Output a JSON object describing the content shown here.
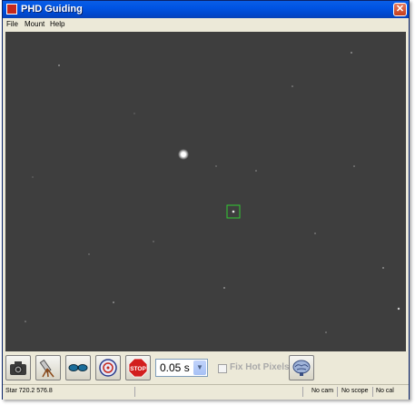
{
  "window": {
    "title": "PHD Guiding",
    "close_glyph": "✕"
  },
  "menu": {
    "items": [
      "File",
      "Mount",
      "Help"
    ]
  },
  "camera_view": {
    "background_color": "#3b3b3b",
    "selection_box_color": "#33cc33"
  },
  "toolbar": {
    "buttons": [
      {
        "name": "camera-connect-button",
        "icon": "camera-icon"
      },
      {
        "name": "scope-connect-button",
        "icon": "telescope-icon"
      },
      {
        "name": "loop-exposure-button",
        "icon": "loop-glasses-icon"
      },
      {
        "name": "guide-button",
        "icon": "phd-target-icon"
      },
      {
        "name": "stop-button",
        "icon": "stop-sign-icon",
        "label": "STOP"
      },
      {
        "name": "advanced-settings-button",
        "icon": "brain-icon"
      }
    ],
    "exposure": {
      "value": "0.05 s"
    },
    "fix_hot_pixels": {
      "label": "Fix Hot Pixels",
      "checked": false
    }
  },
  "status": {
    "star": "Star 720.2 576.8",
    "camera": "No cam",
    "scope": "No scope",
    "calibration": "No cal"
  }
}
